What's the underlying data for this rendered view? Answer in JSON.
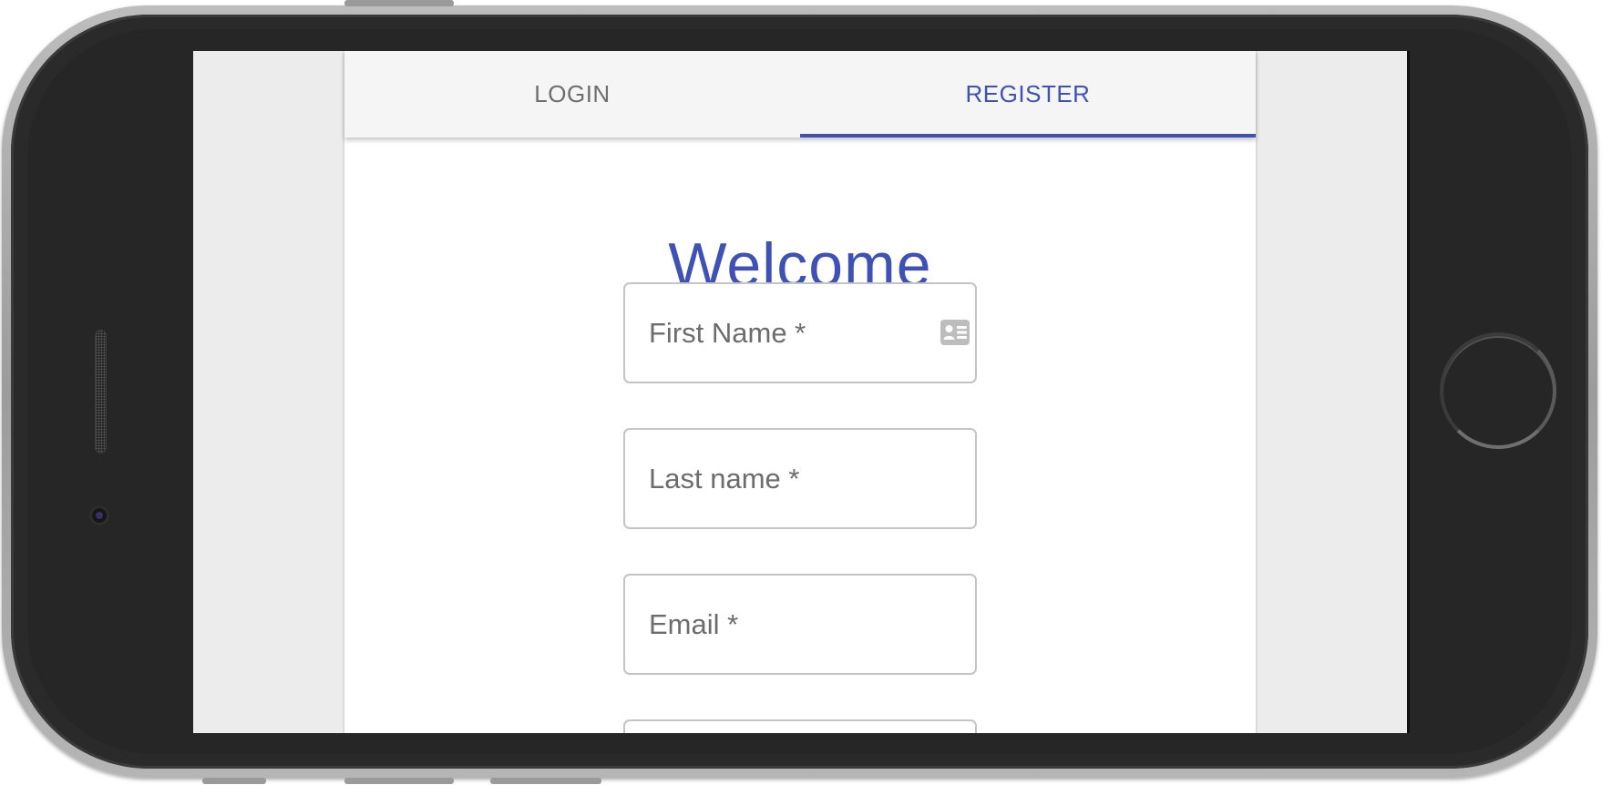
{
  "tabs": {
    "login_label": "LOGIN",
    "register_label": "REGISTER",
    "active": "register"
  },
  "form": {
    "title": "Welcome",
    "fields": [
      {
        "label": "First Name *",
        "icon": "contact-card-icon"
      },
      {
        "label": "Last name *"
      },
      {
        "label": "Email *"
      }
    ]
  },
  "colors": {
    "accent": "#3f51b5",
    "tab_bar": "#f5f5f5",
    "label_gray": "#6c6c6c",
    "screen_background": "#ececec"
  }
}
